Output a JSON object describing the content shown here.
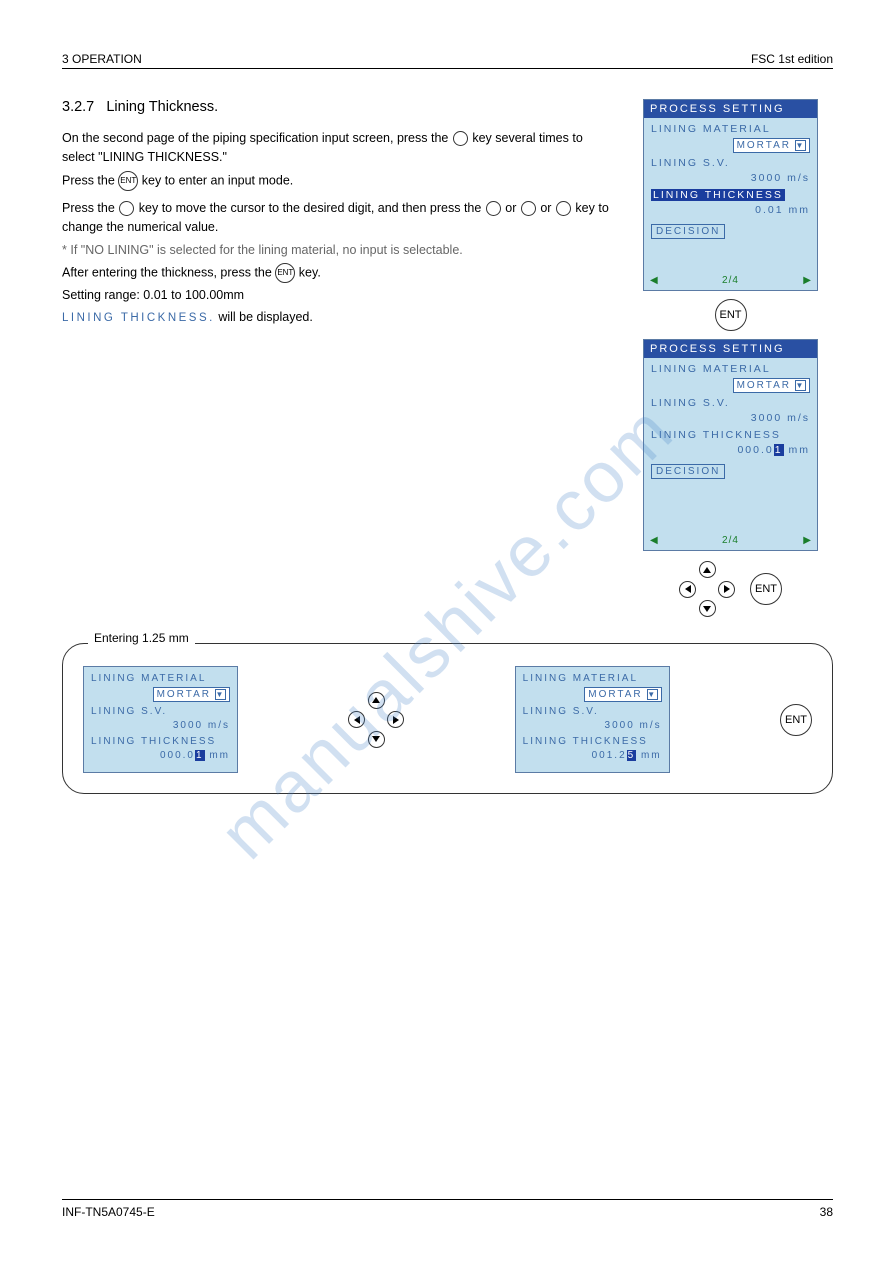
{
  "header": {
    "section": "3  OPERATION",
    "version": "FSC 1st edition"
  },
  "section": {
    "number": "3.2.7",
    "title": "Lining Thickness."
  },
  "steps": {
    "s1": {
      "line1_pre": "On the second page of the piping specification input screen, press the ",
      "line1_post": " key several times to select \"LINING THICKNESS.\"",
      "line2_pre": "Press the ",
      "line2_post": " key to enter an input mode."
    },
    "s2": {
      "line1_prefix": "Press the ",
      "line1_mid": " key to move the cursor to the desired digit, and then press the ",
      "line1_suffix": " or ",
      "line1_end": " key to change the numerical value.",
      "note_label": "*",
      "note_text": " If \"NO LINING\" is selected for the lining material, no input is selectable.",
      "line3_pre": "After entering the thickness, press the ",
      "line3_post": " key.",
      "range_pre": "Setting range: 0.01 to 100.00mm",
      "range_label_text": "LINING THICKNESS.",
      "range_post": " will be displayed."
    }
  },
  "labels": {
    "ent": "ENT"
  },
  "screens": {
    "title": "PROCESS SETTING",
    "lining_material": "LINING MATERIAL",
    "mortar": "MORTAR",
    "lining_sv": "LINING S.V.",
    "sv_val": "3000 m/s",
    "lining_thickness": "LINING THICKNESS",
    "thick_val_a": "0.01 mm",
    "thick_prefix_b": "000.0",
    "thick_digit_b": "1",
    "thick_suffix_b": " mm",
    "decision": "DECISION",
    "page": "2/4"
  },
  "ramp": {
    "label": "Entering 1.25 mm",
    "left_prefix": "000.0",
    "left_digit": "1",
    "left_suffix": " mm",
    "right_prefix": "001.2",
    "right_digit": "5",
    "right_suffix": " mm"
  },
  "footer": {
    "doc": "INF-TN5A0745-E",
    "page": "38"
  }
}
